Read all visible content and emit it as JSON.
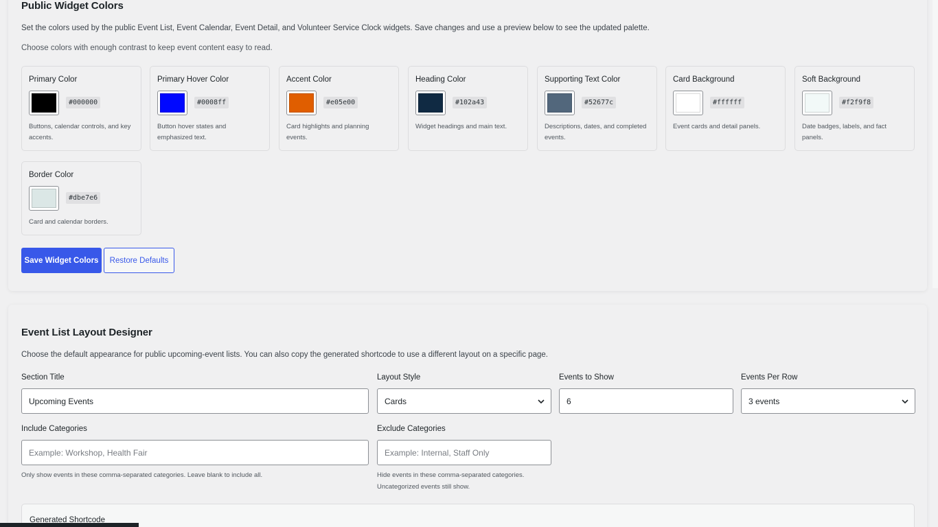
{
  "colors_section": {
    "title": "Public Widget Colors",
    "description": "Set the colors used by the public Event List, Event Calendar, Event Detail, and Volunteer Service Clock widgets. Save changes and use a preview below to see the updated palette.",
    "contrast_note": "Choose colors with enough contrast to keep event content easy to read.",
    "swatches": [
      {
        "label": "Primary Color",
        "hex": "#000000",
        "help": "Buttons, calendar controls, and key accents."
      },
      {
        "label": "Primary Hover Color",
        "hex": "#0008ff",
        "help": "Button hover states and emphasized text."
      },
      {
        "label": "Accent Color",
        "hex": "#e05e00",
        "help": "Card highlights and planning events."
      },
      {
        "label": "Heading Color",
        "hex": "#102a43",
        "help": "Widget headings and main text."
      },
      {
        "label": "Supporting Text Color",
        "hex": "#52677c",
        "help": "Descriptions, dates, and completed events."
      },
      {
        "label": "Card Background",
        "hex": "#ffffff",
        "help": "Event cards and detail panels."
      },
      {
        "label": "Soft Background",
        "hex": "#f2f9f8",
        "help": "Date badges, labels, and fact panels."
      },
      {
        "label": "Border Color",
        "hex": "#dbe7e6",
        "help": "Card and calendar borders."
      }
    ],
    "save_button": "Save Widget Colors",
    "restore_button": "Restore Defaults"
  },
  "layout_section": {
    "title": "Event List Layout Designer",
    "description": "Choose the default appearance for public upcoming-event lists. You can also copy the generated shortcode to use a different layout on a specific page.",
    "section_title_label": "Section Title",
    "section_title_value": "Upcoming Events",
    "layout_style_label": "Layout Style",
    "layout_style_value": "Cards",
    "events_to_show_label": "Events to Show",
    "events_to_show_value": "6",
    "events_per_row_label": "Events Per Row",
    "events_per_row_value": "3 events",
    "include_label": "Include Categories",
    "include_placeholder": "Example: Workshop, Health Fair",
    "include_hint": "Only show events in these comma-separated categories. Leave blank to include all.",
    "exclude_label": "Exclude Categories",
    "exclude_placeholder": "Example: Internal, Staff Only",
    "exclude_hint": "Hide events in these comma-separated categories. Uncategorized events still show.",
    "shortcode_title": "Generated Shortcode"
  },
  "theme": {
    "primary_button": "#3858e9",
    "panel_background": "#f0f0f1"
  }
}
